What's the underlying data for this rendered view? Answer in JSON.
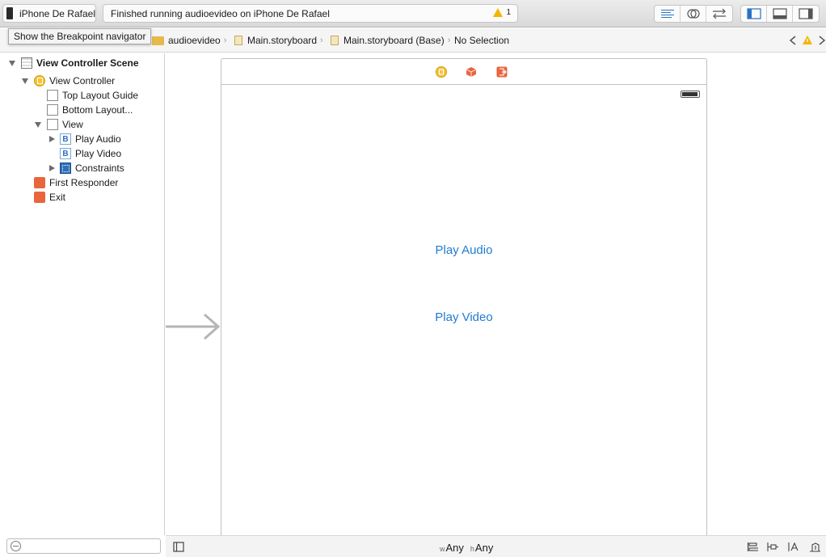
{
  "toolbar": {
    "device": "iPhone De Rafael",
    "status_message": "Finished running audioevideo on iPhone De Rafael",
    "warning_count": "1"
  },
  "tooltip": "Show the Breakpoint navigator",
  "jumpbar": {
    "crumbs": [
      "audioevideo",
      "Main.storyboard",
      "Main.storyboard (Base)",
      "No Selection"
    ]
  },
  "outline": {
    "scene": "View Controller Scene",
    "view_controller": "View Controller",
    "top_layout_guide": "Top Layout Guide",
    "bottom_layout": "Bottom Layout...",
    "view": "View",
    "play_audio": "Play Audio",
    "play_video": "Play Video",
    "constraints": "Constraints",
    "first_responder": "First Responder",
    "exit": "Exit",
    "button_badge": "B"
  },
  "canvas": {
    "play_audio": "Play Audio",
    "play_video": "Play Video"
  },
  "bottom": {
    "w_prefix": "w",
    "w_value": "Any",
    "h_prefix": "h",
    "h_value": "Any"
  },
  "colors": {
    "accent_blue": "#1f7bd1",
    "warning_yellow": "#f2b600",
    "responder_orange": "#e8653e"
  }
}
